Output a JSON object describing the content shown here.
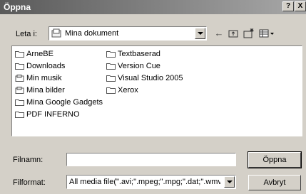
{
  "window": {
    "title": "Öppna",
    "help_label": "?",
    "close_label": "X"
  },
  "lookin": {
    "label": "Leta i:",
    "value": "Mina dokument"
  },
  "toolbar": {
    "back_icon": "back-arrow-icon",
    "up_icon": "up-folder-icon",
    "new_folder_icon": "new-folder-icon",
    "view_icon": "view-menu-icon"
  },
  "files": {
    "column1": [
      "ArneBE",
      "Downloads",
      "Min musik",
      "Mina bilder",
      "Mina Google Gadgets",
      "PDF INFERNO"
    ],
    "column2": [
      "Textbaserad",
      "Version Cue",
      "Visual Studio 2005",
      "Xerox"
    ]
  },
  "filename": {
    "label": "Filnamn:",
    "value": ""
  },
  "filetype": {
    "label": "Filformat:",
    "value": "All media file(\".avi;\".mpeg;\".mpg;\".dat;\".wmv;\""
  },
  "buttons": {
    "open": "Öppna",
    "cancel": "Avbryt"
  }
}
